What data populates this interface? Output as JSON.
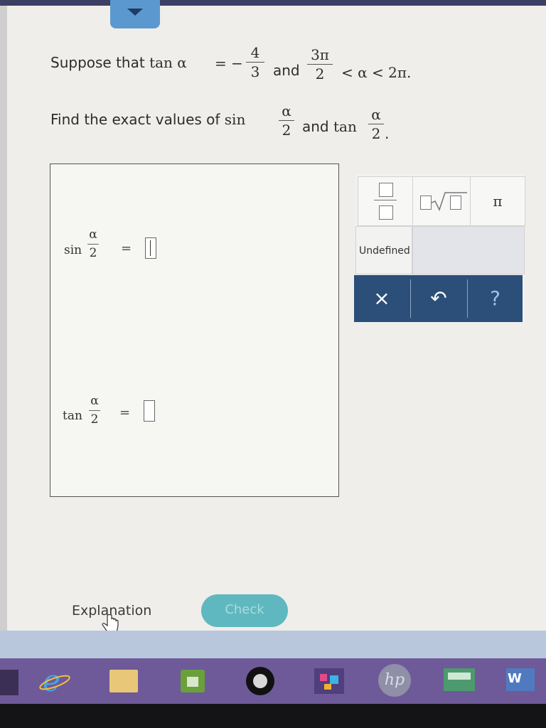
{
  "problem": {
    "line1": {
      "prefix": "Suppose that ",
      "tan_text": "tan α",
      "equals": "=",
      "minus": "−",
      "frac1_num": "4",
      "frac1_den": "3",
      "and": "and",
      "frac2_num": "3π",
      "frac2_den": "2",
      "ineq": "< α < 2π."
    },
    "line2": {
      "prefix": "Find the exact values of ",
      "sin_text": "sin",
      "alpha": "α",
      "two": "2",
      "and": "and",
      "tan_text": "tan",
      "period": "."
    }
  },
  "answers": [
    {
      "func": "sin",
      "num": "α",
      "den": "2",
      "equals": "=",
      "value": ""
    },
    {
      "func": "tan",
      "num": "α",
      "den": "2",
      "equals": "=",
      "value": ""
    }
  ],
  "palette": {
    "fraction_icon": "fraction-icon",
    "radical_icon": "radical-icon",
    "pi_label": "π",
    "undefined_label": "Undefined"
  },
  "tools": {
    "clear": "×",
    "undo": "↶",
    "help": "?"
  },
  "footer": {
    "explanation": "Explanation",
    "check": "Check"
  },
  "taskbar": {
    "icons": [
      "internet-explorer-icon",
      "file-explorer-icon",
      "store-icon",
      "media-player-icon",
      "app-icon",
      "hp-icon",
      "app-icon-2",
      "word-icon"
    ],
    "hp_label": "hp",
    "word_label": "W"
  },
  "colors": {
    "toolbar": "#2b4f79",
    "check_button": "#5fb8bf",
    "taskbar": "#6e5a98",
    "dropdown": "#5b98cf"
  }
}
